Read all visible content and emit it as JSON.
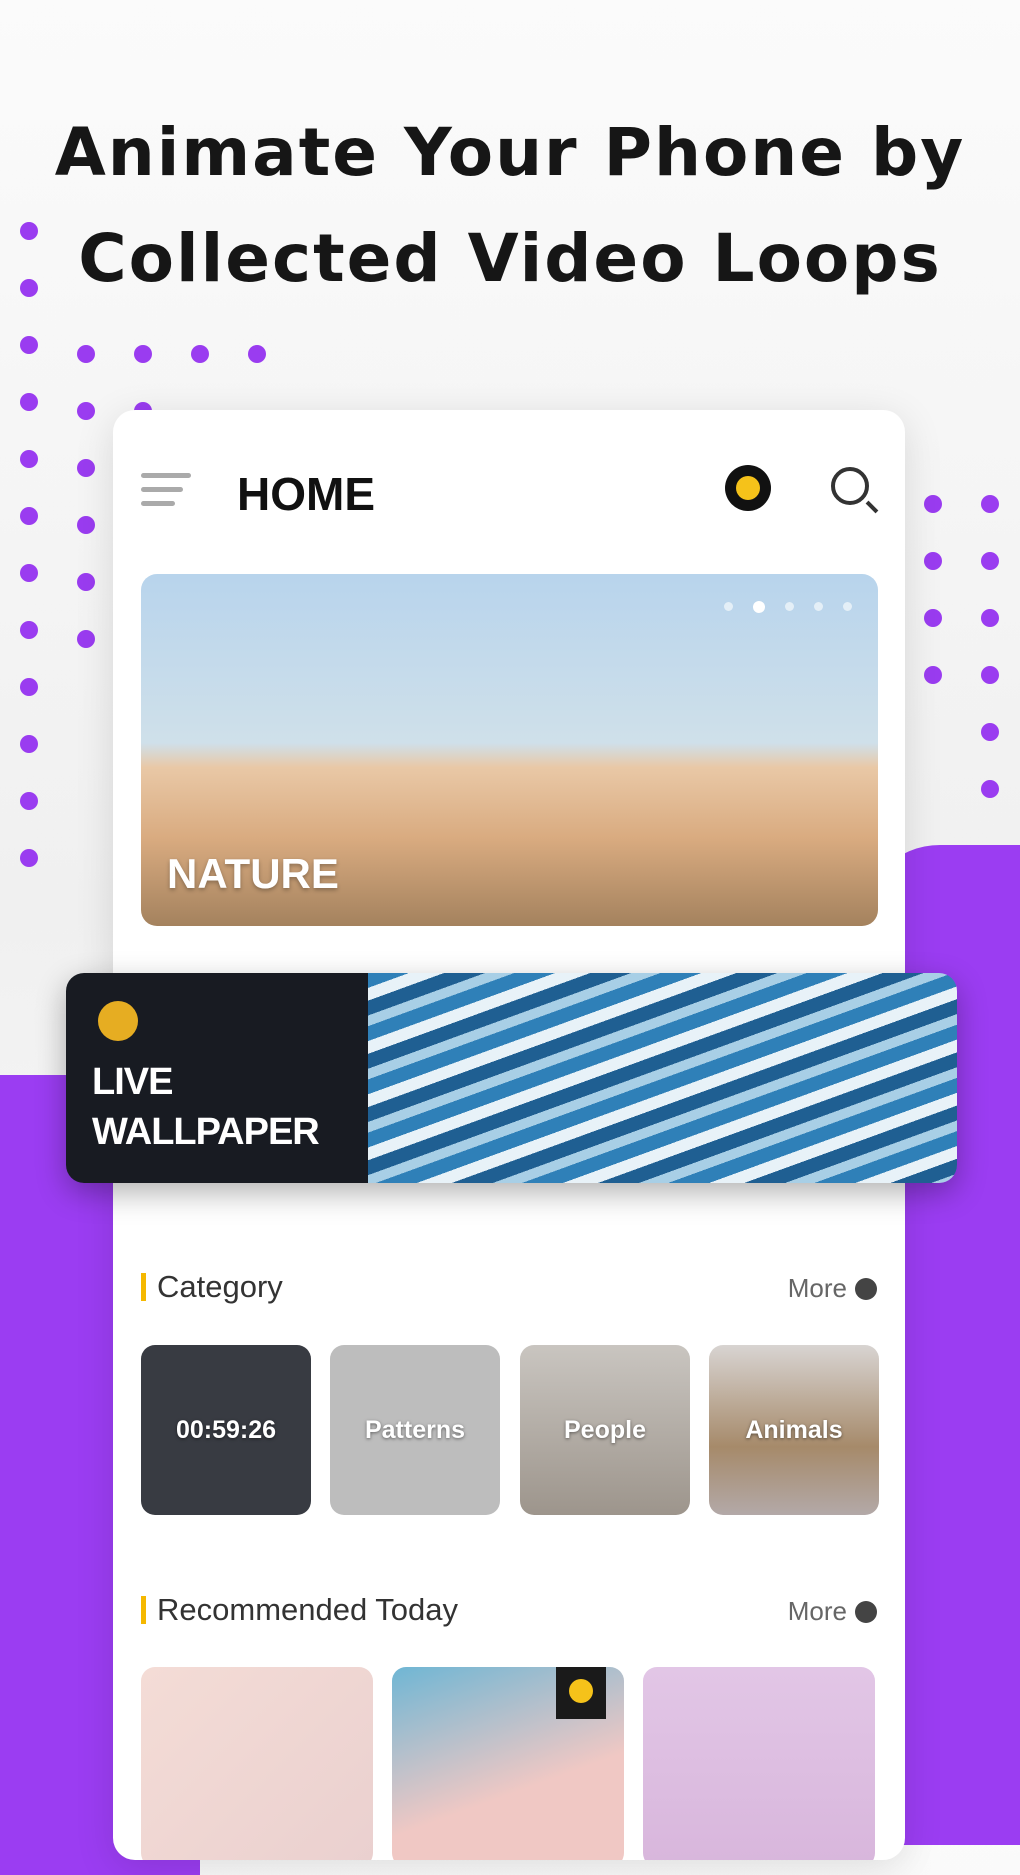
{
  "headline": {
    "line1": "Animate Your Phone by",
    "line2": "Collected Video Loops"
  },
  "colors": {
    "accent": "#9b3df2",
    "gold": "#f5b800",
    "dark": "#181b22"
  },
  "app": {
    "title": "HOME",
    "icons": [
      "menu-icon",
      "premium-coin-icon",
      "search-icon"
    ]
  },
  "banner": {
    "label": "NATURE",
    "pages": 5,
    "active_page": 2
  },
  "live": {
    "label_line1": "LIVE",
    "label_line2": "WALLPAPER",
    "icon": "gold-coin-icon"
  },
  "category": {
    "title": "Category",
    "more": "More",
    "items": [
      {
        "label": "00:59:26"
      },
      {
        "label": "Patterns"
      },
      {
        "label": "People"
      },
      {
        "label": "Animals"
      }
    ]
  },
  "recommended": {
    "title": "Recommended Today",
    "more": "More"
  }
}
